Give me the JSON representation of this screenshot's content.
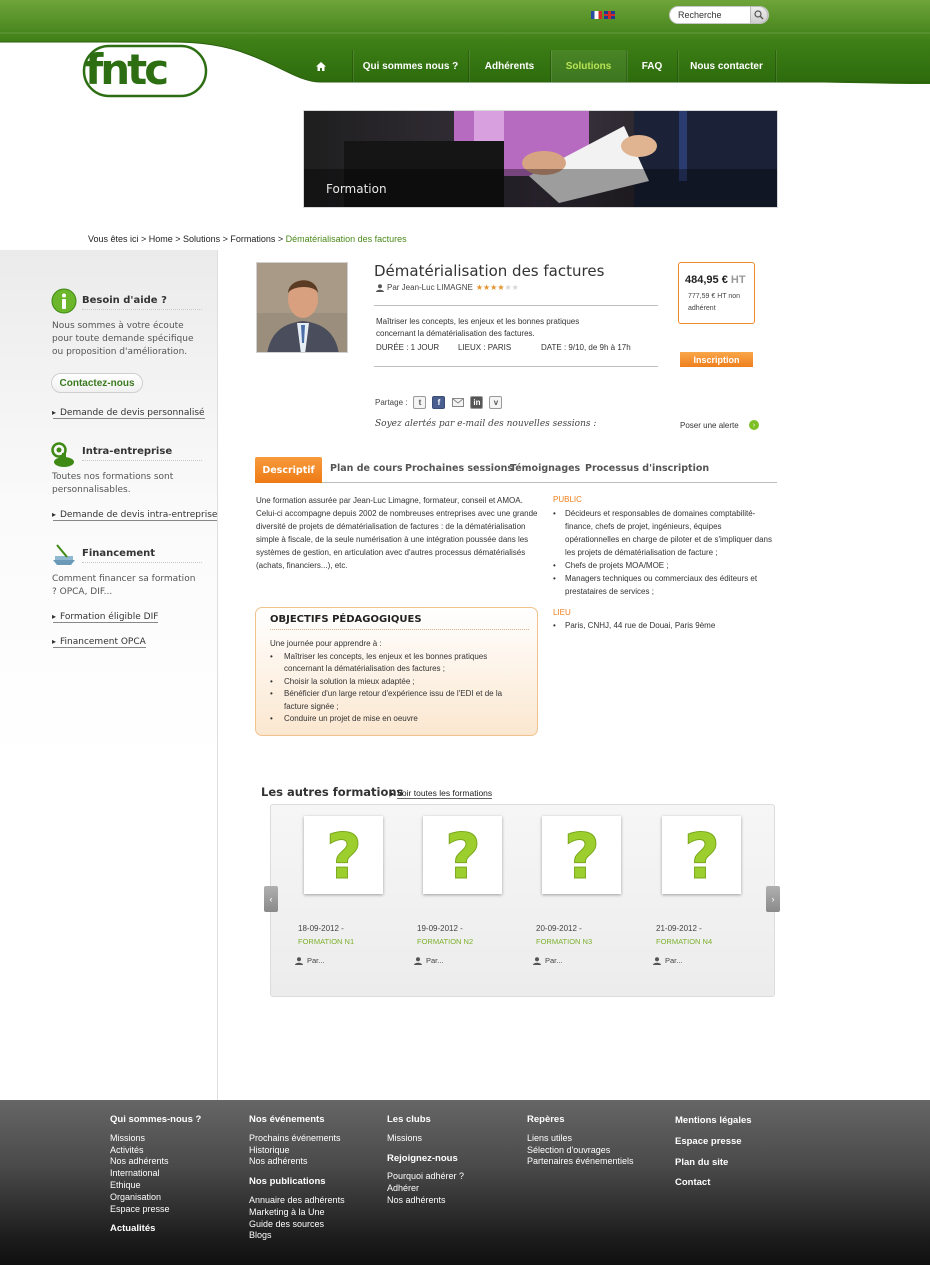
{
  "header": {
    "search_placeholder": "Recherche",
    "nav": [
      "Qui sommes nous ?",
      "Adhérents",
      "Solutions",
      "FAQ",
      "Nous contacter"
    ],
    "active_nav": "Solutions"
  },
  "banner": {
    "label": "Formation"
  },
  "breadcrumb": {
    "prefix": "Vous êtes ici > Home > Solutions > Formations > ",
    "current": "Dématérialisation des factures"
  },
  "sidebar": {
    "help": {
      "title": "Besoin d'aide ?",
      "text": "Nous sommes à votre écoute pour toute demande spécifique ou proposition d'amélioration.",
      "button": "Contactez-nous",
      "link": "Demande de devis personnalisé"
    },
    "intra": {
      "title": "Intra-entreprise",
      "text": "Toutes nos formations sont personnalisables.",
      "link": "Demande de devis intra-entreprise"
    },
    "financement": {
      "title": "Financement",
      "text": "Comment financer sa formation ? OPCA, DIF...",
      "links": [
        "Formation éligible DIF",
        "Financement OPCA"
      ]
    }
  },
  "course": {
    "title": "Dématérialisation des factures",
    "author": "Par Jean-Luc LIMAGNE",
    "rating": 4,
    "rating_max": 6,
    "summary": "Maîtriser les concepts, les enjeux et les bonnes pratiques concernant la dématérialisation des factures.",
    "duration": "DURÉE : 1 JOUR",
    "location": "LIEUX : PARIS",
    "date": "DATE : 9/10, de 9h à 17h",
    "price": "484,95 €",
    "price_unit": "HT",
    "price_non_member": "777,59 € HT non adhérent",
    "register_button": "Inscription",
    "share_label": "Partage :",
    "alert_text": "Soyez alertés par e-mail des nouvelles sessions :",
    "alert_link": "Poser une alerte"
  },
  "tabs": [
    "Descriptif",
    "Plan de cours",
    "Prochaines sessions",
    "Témoignages",
    "Processus d'inscription"
  ],
  "descriptif": {
    "text": "Une formation assurée par Jean-Luc Limagne, formateur, conseil et AMOA. Celui-ci accompagne depuis 2002 de nombreuses entreprises avec une grande diversité de projets de dématérialisation de factures : de la dématérialisation simple à fiscale, de la seule numérisation à une intégration poussée dans les systèmes de gestion, en articulation avec d'autres processus dématérialisés (achats, financiers...), etc.",
    "public_title": "PUBLIC",
    "public_items": [
      "Décideurs et responsables de domaines comptabilité-finance, chefs de projet, ingénieurs, équipes opérationnelles en charge de piloter et de s'impliquer dans les projets de dématérialisation de facture ;",
      "Chefs de projets MOA/MOE ;",
      "Managers techniques ou commerciaux des éditeurs et prestataires de services ;"
    ],
    "lieu_title": "LIEU",
    "lieu_items": [
      "Paris, CNHJ, 44 rue de Douai, Paris 9ème"
    ]
  },
  "objectifs": {
    "title": "OBJECTIFS PÉDAGOGIQUES",
    "intro": "Une journée pour apprendre à :",
    "items": [
      "Maîtriser les concepts, les enjeux et les bonnes pratiques concernant la dématérialisation des factures ;",
      "Choisir la solution la mieux adaptée ;",
      "Bénéficier d'un large retour d'expérience issu de l'EDI et de la facture signée ;",
      "Conduire un projet de mise en oeuvre"
    ]
  },
  "others": {
    "title": "Les autres formations",
    "see_all": "Voir toutes les formations",
    "cards": [
      {
        "date": "18-09-2012 -",
        "name": "FORMATION N1",
        "by": "Par..."
      },
      {
        "date": "19-09-2012 -",
        "name": "FORMATION N2",
        "by": "Par..."
      },
      {
        "date": "20-09-2012 -",
        "name": "FORMATION N3",
        "by": "Par..."
      },
      {
        "date": "21-09-2012 -",
        "name": "FORMATION N4",
        "by": "Par..."
      }
    ]
  },
  "footer": {
    "col1": {
      "title": "Qui sommes-nous ?",
      "links": [
        "Missions",
        "Activités",
        "Nos adhérents",
        "International",
        "Ethique",
        "Organisation",
        "Espace presse"
      ],
      "title2": "Actualités"
    },
    "col2": {
      "title": "Nos événements",
      "links": [
        "Prochains événements",
        "Historique",
        "Nos adhérents"
      ],
      "title2": "Nos publications",
      "links2": [
        "Annuaire des adhérents",
        "Marketing à la Une",
        "Guide des sources",
        "Blogs"
      ]
    },
    "col3": {
      "title": "Les clubs",
      "links": [
        "Missions"
      ],
      "title2": "Rejoignez-nous",
      "links2": [
        "Pourquoi adhérer ?",
        "Adhérer",
        "Nos adhérents"
      ]
    },
    "col4": {
      "title": "Repères",
      "links": [
        "Liens utiles",
        "Sélection d'ouvrages",
        "Partenaires événementiels"
      ]
    },
    "col5": {
      "titles": [
        "Mentions légales",
        "Espace presse",
        "Plan du site",
        "Contact"
      ]
    }
  },
  "colors": {
    "brand_green": "#3b7d12",
    "accent_orange": "#ef7f1d",
    "link_green": "#7cb02c"
  }
}
